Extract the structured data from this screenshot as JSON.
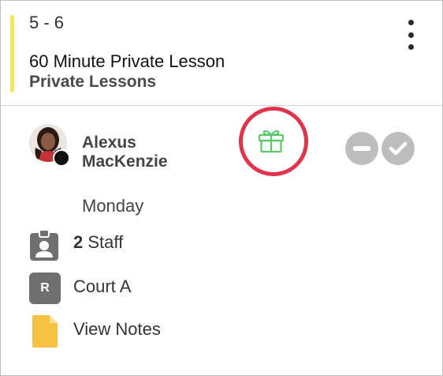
{
  "session": {
    "time": "5 - 6",
    "title": "60 Minute Private Lesson",
    "category": "Private Lessons"
  },
  "client": {
    "name": "Alexus MacKenzie",
    "day": "Monday"
  },
  "details": {
    "staff_count": "2",
    "staff_label": "Staff",
    "resource_badge": "R",
    "resource_name": "Court A",
    "notes_label": "View Notes"
  },
  "colors": {
    "accent_bar": "#f4e65a",
    "highlight_ring": "#e0344a",
    "gift_icon": "#5ac86a",
    "action_buttons": "#bdbdbd",
    "notes_icon": "#f5c242"
  },
  "icons": [
    "more-vertical-icon",
    "gift-icon",
    "remove-icon",
    "check-icon",
    "staff-badge-icon",
    "note-icon"
  ]
}
